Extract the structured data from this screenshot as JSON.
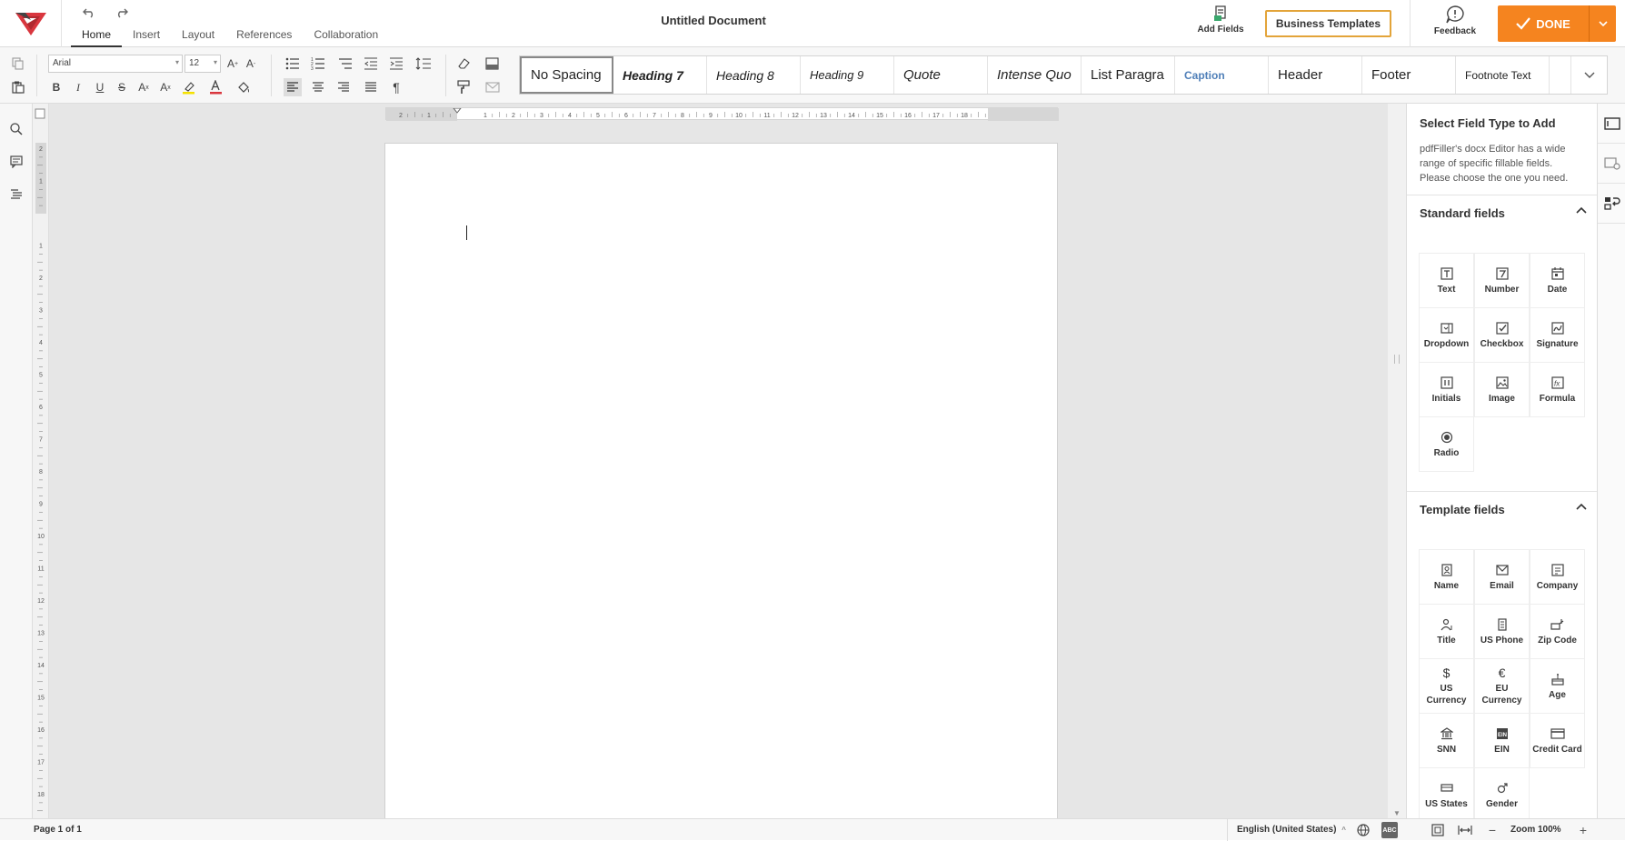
{
  "header": {
    "doc_title": "Untitled Document",
    "tabs": [
      "Home",
      "Insert",
      "Layout",
      "References",
      "Collaboration"
    ],
    "add_fields_label": "Add Fields",
    "business_templates_label": "Business Templates",
    "feedback_label": "Feedback",
    "done_label": "DONE"
  },
  "toolbar": {
    "font_family": "Arial",
    "font_size": "12",
    "styles": [
      "No Spacing",
      "Heading 7",
      "Heading 8",
      "Heading 9",
      "Quote",
      "Intense Quo",
      "List Paragra",
      "Caption",
      "Header",
      "Footer",
      "Footnote Text"
    ]
  },
  "right_panel": {
    "title": "Select Field Type to Add",
    "description": "pdfFiller's docx Editor has a wide range of specific fillable fields. Please choose the one you need.",
    "standard_header": "Standard fields",
    "standard_fields": [
      {
        "label": "Text",
        "icon": "text-field-icon"
      },
      {
        "label": "Number",
        "icon": "number-field-icon"
      },
      {
        "label": "Date",
        "icon": "date-field-icon"
      },
      {
        "label": "Dropdown",
        "icon": "dropdown-field-icon"
      },
      {
        "label": "Checkbox",
        "icon": "checkbox-field-icon"
      },
      {
        "label": "Signature",
        "icon": "signature-field-icon"
      },
      {
        "label": "Initials",
        "icon": "initials-field-icon"
      },
      {
        "label": "Image",
        "icon": "image-field-icon"
      },
      {
        "label": "Formula",
        "icon": "formula-field-icon"
      },
      {
        "label": "Radio",
        "icon": "radio-field-icon"
      }
    ],
    "template_header": "Template fields",
    "template_fields": [
      {
        "label": "Name",
        "icon": "name-field-icon"
      },
      {
        "label": "Email",
        "icon": "email-field-icon"
      },
      {
        "label": "Company",
        "icon": "company-field-icon"
      },
      {
        "label": "Title",
        "icon": "title-field-icon"
      },
      {
        "label": "US Phone",
        "icon": "phone-field-icon"
      },
      {
        "label": "Zip Code",
        "icon": "zip-field-icon"
      },
      {
        "label": "US Currency",
        "icon": "dollar-icon"
      },
      {
        "label": "EU Currency",
        "icon": "euro-icon"
      },
      {
        "label": "Age",
        "icon": "age-field-icon"
      },
      {
        "label": "SNN",
        "icon": "bank-icon"
      },
      {
        "label": "EIN",
        "icon": "ein-field-icon"
      },
      {
        "label": "Credit Card",
        "icon": "credit-card-icon"
      },
      {
        "label": "US States",
        "icon": "flag-icon"
      },
      {
        "label": "Gender",
        "icon": "gender-icon"
      }
    ]
  },
  "status": {
    "page_count": "Page 1 of 1",
    "language": "English (United States)",
    "zoom": "Zoom 100%"
  },
  "ruler": {
    "h_labels": [
      "2",
      "1",
      "1",
      "2",
      "3",
      "4",
      "5",
      "6",
      "7",
      "8",
      "9",
      "10",
      "11",
      "12",
      "13",
      "14",
      "15",
      "16",
      "17",
      "18"
    ],
    "v_labels": [
      "2",
      "1",
      "1",
      "2",
      "3",
      "4",
      "5",
      "6",
      "7",
      "8",
      "9",
      "10",
      "11",
      "12",
      "13",
      "14",
      "15",
      "16",
      "17",
      "18"
    ]
  },
  "colors": {
    "accent": "#f5841f",
    "border_gold": "#e3a43a",
    "brand_red": "#d9363e"
  }
}
